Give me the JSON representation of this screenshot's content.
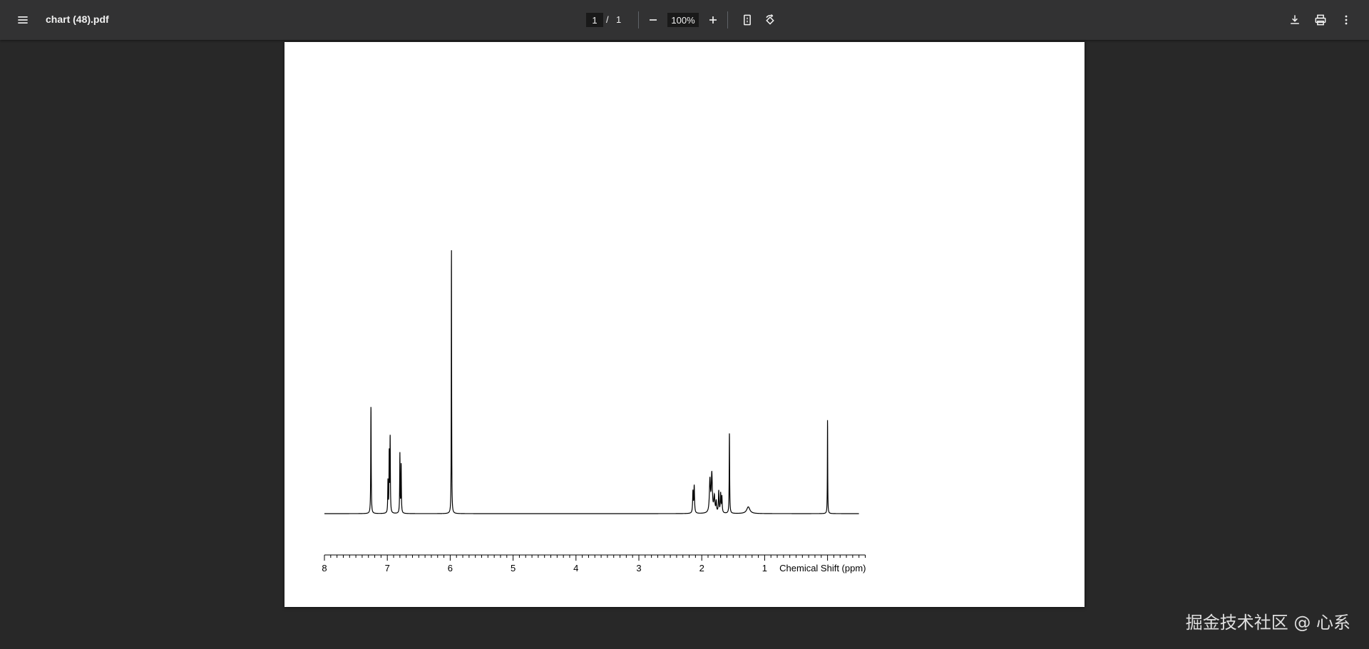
{
  "toolbar": {
    "menu_icon": "hamburger-menu-icon",
    "title": "chart (48).pdf",
    "page_current": "1",
    "page_separator": "/",
    "page_total": "1",
    "zoom_out_icon": "minus-icon",
    "zoom_level": "100%",
    "zoom_in_icon": "plus-icon",
    "fit_icon": "fit-to-page-icon",
    "rotate_icon": "rotate-icon",
    "download_icon": "download-icon",
    "print_icon": "print-icon",
    "more_icon": "more-vertical-icon"
  },
  "chart_data": {
    "type": "line",
    "xlabel": "Chemical Shift (ppm)",
    "title": "",
    "ylabel": "",
    "xlim": [
      8,
      -0.6
    ],
    "x_reversed": true,
    "x_ticks": [
      "8",
      "7",
      "6",
      "5",
      "4",
      "3",
      "2",
      "1"
    ],
    "x_tick_values": [
      8,
      7,
      6,
      5,
      4,
      3,
      2,
      1
    ],
    "y_relative_intensity_range": [
      0,
      1
    ],
    "baseline": 0,
    "peaks": [
      {
        "x": 7.26,
        "height": 0.4,
        "width": 0.004
      },
      {
        "x": 6.99,
        "height": 0.12,
        "width": 0.004
      },
      {
        "x": 6.97,
        "height": 0.22,
        "width": 0.004
      },
      {
        "x": 6.955,
        "height": 0.28,
        "width": 0.004
      },
      {
        "x": 6.8,
        "height": 0.22,
        "width": 0.004
      },
      {
        "x": 6.78,
        "height": 0.18,
        "width": 0.004
      },
      {
        "x": 5.98,
        "height": 1.0,
        "width": 0.003
      },
      {
        "x": 2.14,
        "height": 0.08,
        "width": 0.006
      },
      {
        "x": 2.12,
        "height": 0.1,
        "width": 0.006
      },
      {
        "x": 1.87,
        "height": 0.12,
        "width": 0.01
      },
      {
        "x": 1.84,
        "height": 0.14,
        "width": 0.01
      },
      {
        "x": 1.8,
        "height": 0.06,
        "width": 0.01
      },
      {
        "x": 1.77,
        "height": 0.04,
        "width": 0.006
      },
      {
        "x": 1.73,
        "height": 0.08,
        "width": 0.006
      },
      {
        "x": 1.7,
        "height": 0.07,
        "width": 0.006
      },
      {
        "x": 1.68,
        "height": 0.06,
        "width": 0.006
      },
      {
        "x": 1.56,
        "height": 0.3,
        "width": 0.004
      },
      {
        "x": 1.26,
        "height": 0.025,
        "width": 0.03
      },
      {
        "x": 0.0,
        "height": 0.355,
        "width": 0.003
      }
    ]
  },
  "watermark": "掘金技术社区 @ 心系"
}
